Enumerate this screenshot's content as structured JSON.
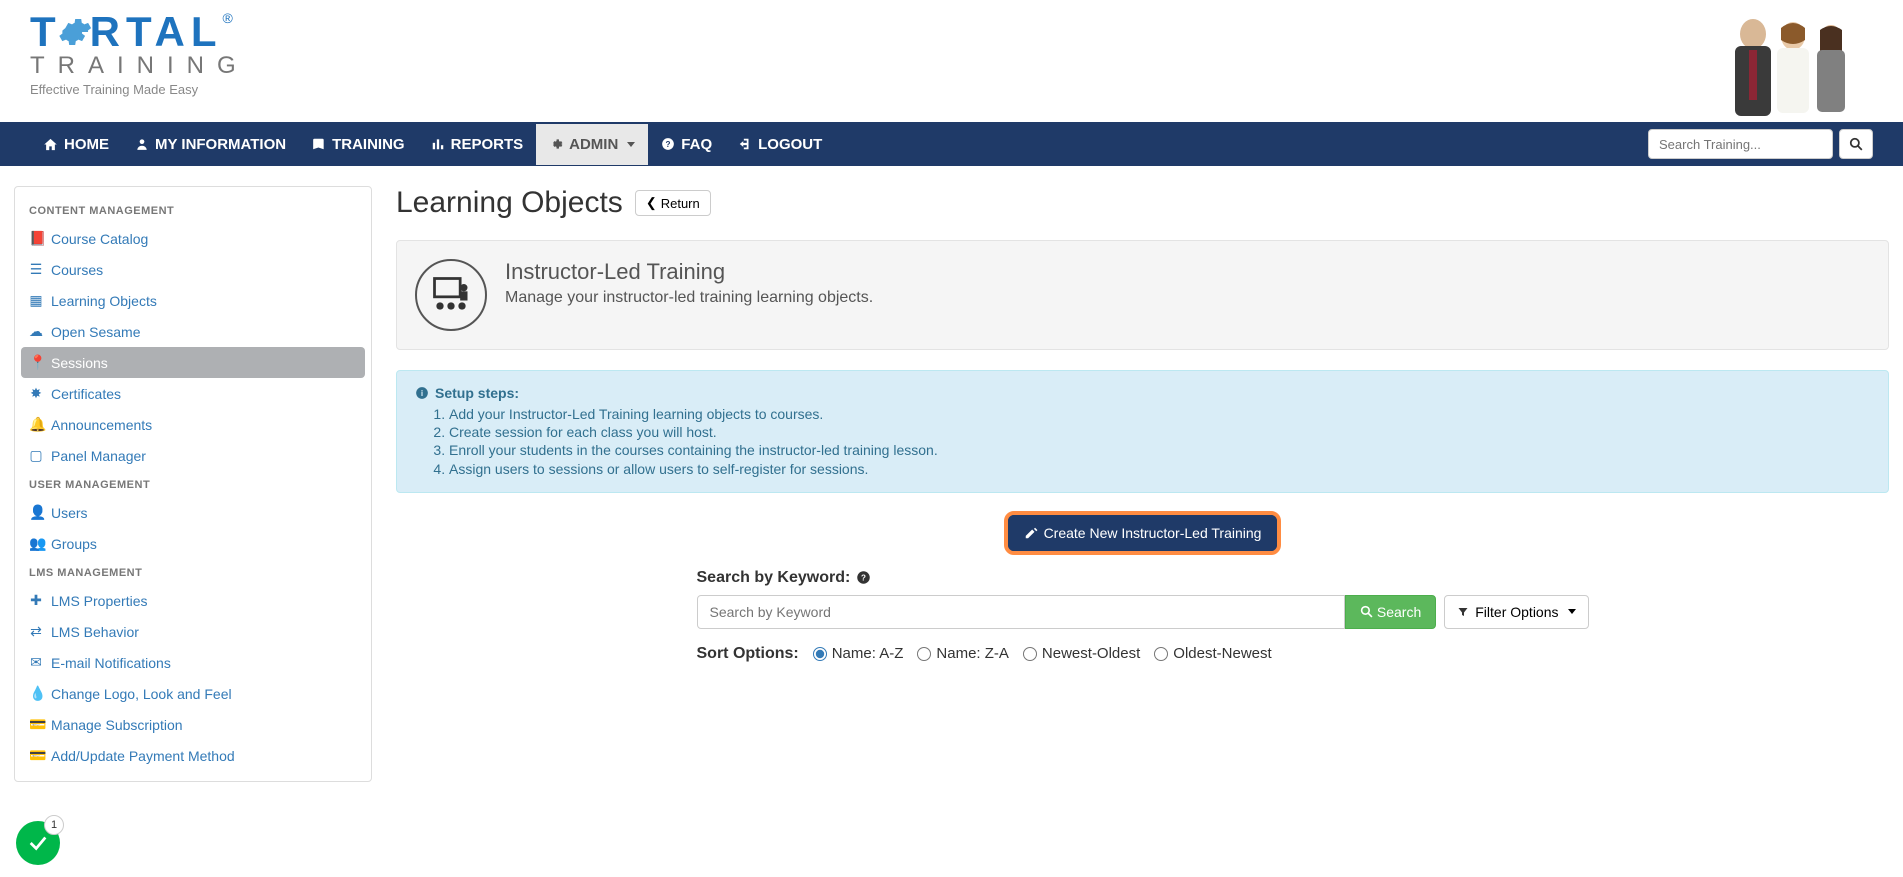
{
  "logo": {
    "main": "T   RTAL",
    "sub": "TRAINING",
    "tag": "Effective Training Made Easy",
    "reg": "®"
  },
  "nav": {
    "home": "HOME",
    "myinfo": "MY INFORMATION",
    "training": "TRAINING",
    "reports": "REPORTS",
    "admin": "ADMIN",
    "faq": "FAQ",
    "logout": "LOGOUT",
    "search_placeholder": "Search Training..."
  },
  "sidebar": {
    "headings": {
      "content": "CONTENT MANAGEMENT",
      "user": "USER MANAGEMENT",
      "lms": "LMS MANAGEMENT"
    },
    "content": [
      {
        "label": "Course Catalog",
        "icon": "book"
      },
      {
        "label": "Courses",
        "icon": "list"
      },
      {
        "label": "Learning Objects",
        "icon": "grid"
      },
      {
        "label": "Open Sesame",
        "icon": "cloud"
      },
      {
        "label": "Sessions",
        "icon": "pin",
        "active": true
      },
      {
        "label": "Certificates",
        "icon": "star"
      },
      {
        "label": "Announcements",
        "icon": "bell"
      },
      {
        "label": "Panel Manager",
        "icon": "panel"
      }
    ],
    "user": [
      {
        "label": "Users",
        "icon": "user"
      },
      {
        "label": "Groups",
        "icon": "users"
      }
    ],
    "lms": [
      {
        "label": "LMS Properties",
        "icon": "plus"
      },
      {
        "label": "LMS Behavior",
        "icon": "swap"
      },
      {
        "label": "E-mail Notifications",
        "icon": "mail"
      },
      {
        "label": "Change Logo, Look and Feel",
        "icon": "drop"
      },
      {
        "label": "Manage Subscription",
        "icon": "card"
      },
      {
        "label": "Add/Update Payment Method",
        "icon": "card"
      }
    ]
  },
  "page": {
    "title": "Learning Objects",
    "return": "Return",
    "info_title": "Instructor-Led Training",
    "info_desc": "Manage your instructor-led training learning objects.",
    "setup_title": "Setup steps:",
    "steps": [
      "Add your Instructor-Led Training learning objects to courses.",
      "Create session for each class you will host.",
      "Enroll your students in the courses containing the instructor-led training lesson.",
      "Assign users to sessions or allow users to self-register for sessions."
    ],
    "create_btn": "Create New Instructor-Led Training",
    "search_label": "Search by Keyword:",
    "search_placeholder": "Search by Keyword",
    "search_btn": "Search",
    "filter_btn": "Filter Options",
    "sort_label": "Sort Options:",
    "sort_opts": [
      "Name: A-Z",
      "Name: Z-A",
      "Newest-Oldest",
      "Oldest-Newest"
    ]
  },
  "status": {
    "count": "1"
  }
}
